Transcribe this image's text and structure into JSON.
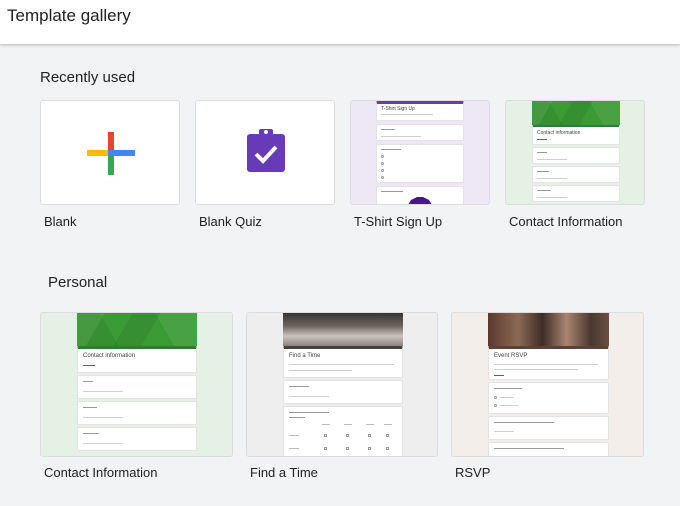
{
  "header": {
    "title": "Template gallery"
  },
  "recent": {
    "heading": "Recently used",
    "cards": [
      {
        "label": "Blank"
      },
      {
        "label": "Blank Quiz"
      },
      {
        "label": "T-Shirt Sign Up",
        "preview_title": "T-Shirt Sign Up"
      },
      {
        "label": "Contact Information",
        "preview_title": "Contact information"
      }
    ]
  },
  "personal": {
    "heading": "Personal",
    "cards": [
      {
        "label": "Contact Information",
        "preview_title": "Contact information"
      },
      {
        "label": "Find a Time",
        "preview_title": "Find a Time"
      },
      {
        "label": "RSVP",
        "preview_title": "Event RSVP"
      }
    ]
  },
  "colors": {
    "google_red": "#ea4335",
    "google_blue": "#4285f4",
    "google_yellow": "#fbbc05",
    "google_green": "#34a853",
    "quiz_purple": "#673ab7",
    "tshirt_purple": "#673ab7",
    "contact_green": "#3a9b35"
  }
}
